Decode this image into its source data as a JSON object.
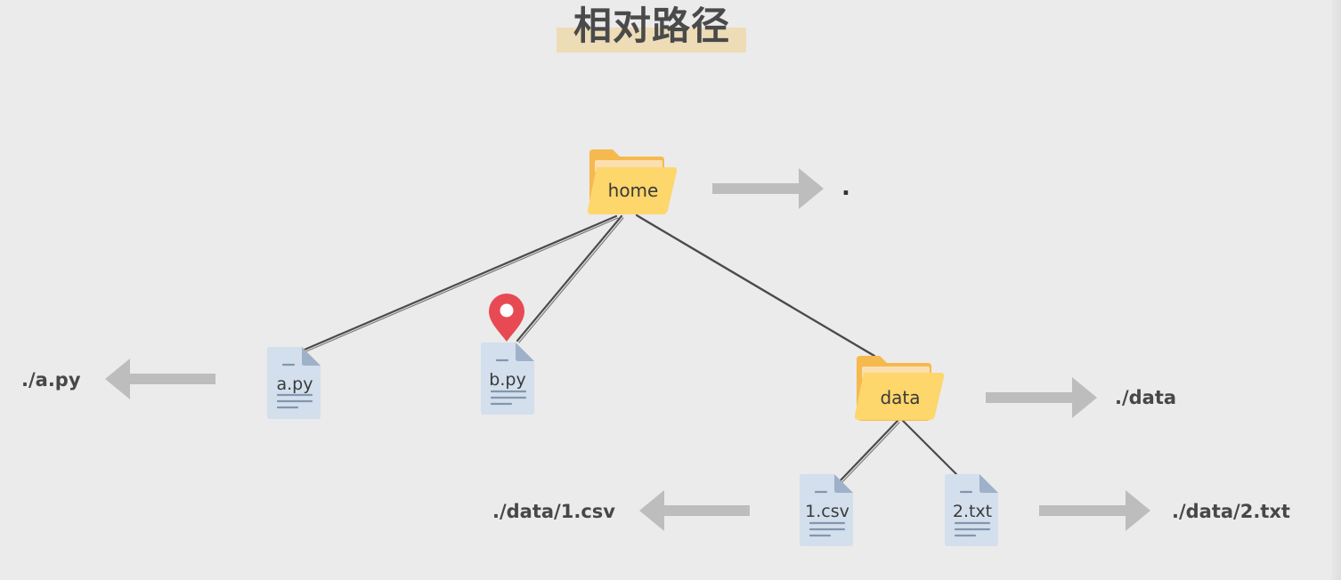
{
  "title": "相对路径",
  "nodes": {
    "home": {
      "label": "home",
      "type": "folder",
      "path": "."
    },
    "a_py": {
      "label": "a.py",
      "type": "file",
      "path": "./a.py"
    },
    "b_py": {
      "label": "b.py",
      "type": "file",
      "marker": "location-pin"
    },
    "data": {
      "label": "data",
      "type": "folder",
      "path": "./data"
    },
    "csv": {
      "label": "1.csv",
      "type": "file",
      "path": "./data/1.csv"
    },
    "txt": {
      "label": "2.txt",
      "type": "file",
      "path": "./data/2.txt"
    }
  },
  "edges": [
    [
      "home",
      "a_py"
    ],
    [
      "home",
      "b_py"
    ],
    [
      "home",
      "data"
    ],
    [
      "data",
      "csv"
    ],
    [
      "data",
      "txt"
    ]
  ],
  "colors": {
    "background": "#ebebeb",
    "title_highlight": "#eedcb7",
    "folder_back": "#f6b94e",
    "folder_front": "#fdd66c",
    "file_page": "#d3dfec",
    "file_fold": "#9eb1c8",
    "file_lines": "#8396ae",
    "arrow": "#bdbdbd",
    "edge": "#4b4b4b",
    "pin": "#e84a53"
  },
  "icons": {
    "folder": "folder-icon",
    "file": "file-icon",
    "marker": "map-pin-icon",
    "arrow": "arrow-icon"
  }
}
